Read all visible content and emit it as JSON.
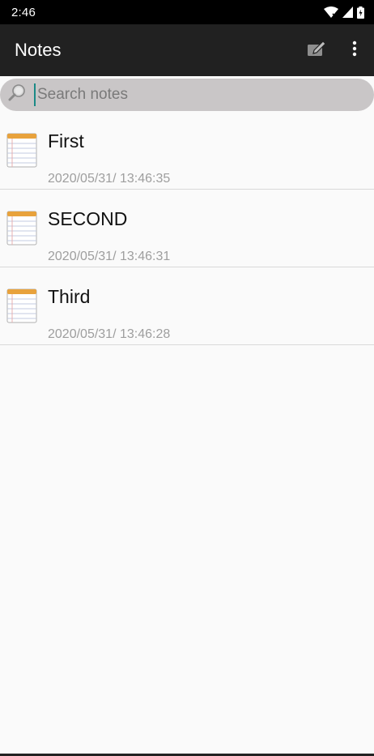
{
  "status_bar": {
    "time": "2:46",
    "icons": [
      "wifi-icon",
      "signal-icon",
      "battery-icon"
    ]
  },
  "app_bar": {
    "title": "Notes",
    "actions": [
      "new-note-icon",
      "more-vert-icon"
    ]
  },
  "search": {
    "placeholder": "Search notes",
    "value": ""
  },
  "notes": [
    {
      "title": "First",
      "date": "2020/05/31/ 13:46:35"
    },
    {
      "title": "SECOND",
      "date": "2020/05/31/ 13:46:31"
    },
    {
      "title": "Third",
      "date": "2020/05/31/ 13:46:28"
    }
  ],
  "colors": {
    "status_bar": "#000000",
    "app_bar": "#212121",
    "search_bg": "#c9c6c7",
    "cursor": "#1a8a86",
    "background": "#fafafa"
  }
}
